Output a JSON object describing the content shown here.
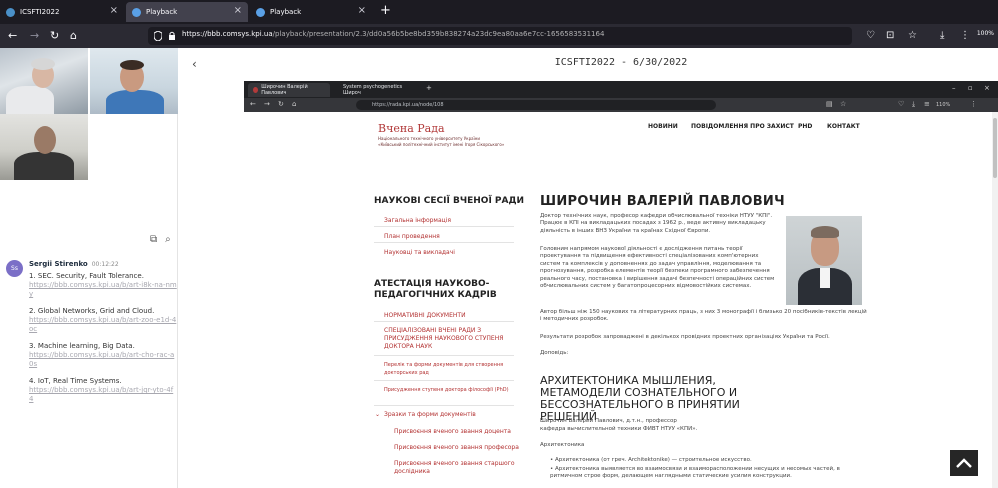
{
  "browser": {
    "tabs": [
      {
        "title": "ICSFTI2022",
        "active": false
      },
      {
        "title": "Playback",
        "active": true
      },
      {
        "title": "Playback",
        "active": false
      }
    ],
    "url_host": "https://bbb.comsys.kpi.ua",
    "url_rest": "/playback/presentation/2.3/dd0a56b5be8bd359b838274a23dc9ea80aa6e7cc-1656583531164",
    "zoom": "100%"
  },
  "chat": {
    "author": "Sergii Stirenko",
    "avatar_initials": "Ss",
    "time": "00:12:22",
    "items": [
      {
        "text": "1. SEC. Security, Fault Tolerance.",
        "link": "https://bbb.comsys.kpi.ua/b/art-i8k-na-nmy"
      },
      {
        "text": "2. Global Networks, Grid and Cloud.",
        "link": "https://bbb.comsys.kpi.ua/b/art-zoo-e1d-4oc"
      },
      {
        "text": "3. Machine learning, Big Data.",
        "link": "https://bbb.comsys.kpi.ua/b/art-cho-rac-a0s"
      },
      {
        "text": "4. IoT, Real Time Systems.",
        "link": "https://bbb.comsys.kpi.ua/b/art-jqr-yto-4f4"
      }
    ]
  },
  "presentation": {
    "title": "ICSFTI2022 - 6/30/2022"
  },
  "slide": {
    "tabs": [
      "Широчин Валерій Павлович",
      "System psychogenetics Широч"
    ],
    "url": "https://rada.kpi.ua/node/108",
    "zoom": "110%",
    "logo_title": "Вчена Рада",
    "logo_lines": [
      "Національного технічного університету України",
      "«Київський політехнічний інститут імені Ігоря Сікорського»"
    ],
    "nav": [
      "НОВИНИ",
      "ПОВІДОМЛЕННЯ ПРО ЗАХИСТ",
      "PHD",
      "КОНТАКТ"
    ],
    "side_section1": "НАУКОВІ СЕСІЇ ВЧЕНОЇ РАДИ",
    "side_links1": [
      "Загальна інформація",
      "План проведення",
      "Науковці та викладачі"
    ],
    "side_section2": "АТЕСТАЦІЯ НАУКОВО-ПЕДАГОГІЧНИХ КАДРІВ",
    "side_links2": [
      "НОРМАТИВНІ ДОКУМЕНТИ",
      "СПЕЦІАЛІЗОВАНІ ВЧЕНІ РАДИ З ПРИСУДЖЕННЯ НАУКОВОГО СТУПЕНЯ ДОКТОРА НАУК",
      "Перелік та форми документів для створення докторських рад",
      "Присудження ступеня доктора філософії (PhD)",
      "Зразки та форми документів",
      "Присвоєння вченого звання доцента",
      "Присвоєння вченого звання професора",
      "Присвоєння вченого звання старшого дослідника"
    ],
    "person_name": "ШИРОЧИН ВАЛЕРІЙ ПАВЛОВИЧ",
    "bio1": "Доктор технічних наук, професор кафедри обчислювальної техніки НТУУ \"КПІ\". Працює в КПІ на викладацьких посадах з 1962 р., веде активну викладацьку діяльність в інших ВНЗ України та країнах Східної Європи.",
    "bio2": "Головним напрямом наукової діяльності є дослідження питань теорії проектування та підвищення ефективності спеціалізованих комп'ютерних систем та комплексів у доповненнях до задач управління, моделювання та прогнозування, розробка елементів теорії безпеки програмного забезпечення реального часу, постановка і вирішення задачі безпечності операційних систем обчислювальних систем у багатопроцесорних відмовостійких системах.",
    "bio3": "Автор більш ніж 150 наукових та літературних праць, з них 3 монографії і близько 20 посібників-текстів лекцій і методичних розробок.",
    "bio4": "Результати розробок запроваджені в декількох провідних проектних організаціях України та Росії.",
    "bio5": "Доповідь:",
    "article_title": "АРХИТЕКТОНИКА МЫШЛЕНИЯ, МЕТАМОДЕЛИ СОЗНАТЕЛЬНОГО И БЕССОЗНАТЕЛЬНОГО В ПРИНЯТИИ РЕШЕНИЙ",
    "article_author": "Широчин Валерий Павлович, д.т.н., профессор",
    "article_dept": "кафедра вычислительной техники ФИВТ НТУУ «КПИ».",
    "article_sub": "Архитектоника",
    "bullets": [
      "Архитектоника (от греч. Architektonike) — строительное искусство.",
      "Архитектоника выявляется во взаимосвязи и взаиморасположении несущих и несомых частей, в ритмичном строе форм, делающем наглядными статические усилия конструкции."
    ]
  }
}
